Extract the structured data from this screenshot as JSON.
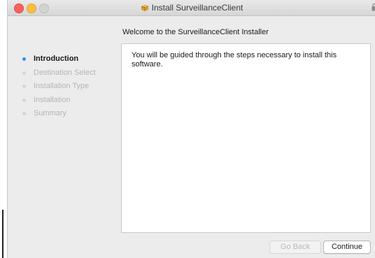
{
  "window": {
    "title": "Install SurveillanceClient"
  },
  "heading": "Welcome to the SurveillanceClient Installer",
  "steps": [
    {
      "label": "Introduction",
      "active": true
    },
    {
      "label": "Destination Select",
      "active": false
    },
    {
      "label": "Installation Type",
      "active": false
    },
    {
      "label": "Installation",
      "active": false
    },
    {
      "label": "Summary",
      "active": false
    }
  ],
  "content": {
    "text": "You will be guided through the steps necessary to install this software."
  },
  "buttons": {
    "back_label": "Go Back",
    "continue_label": "Continue"
  },
  "icons": {
    "title_icon": "package-icon",
    "lock": "lock-icon"
  },
  "colors": {
    "active_step_dot": "#2e8ef7",
    "close": "#fc605c",
    "minimize": "#fdbc40",
    "maximize_disabled": "#d3d3d3"
  }
}
